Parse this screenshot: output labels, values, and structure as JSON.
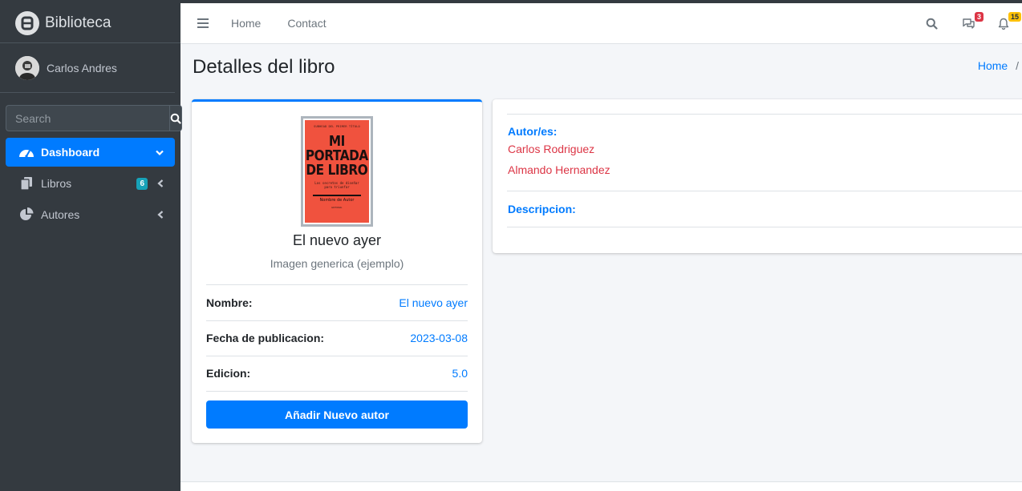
{
  "sidebar": {
    "brand": "Biblioteca",
    "user_name": "Carlos Andres",
    "search_placeholder": "Search",
    "items": [
      {
        "label": "Dashboard",
        "icon": "tachometer-icon"
      },
      {
        "label": "Libros",
        "icon": "copy-icon",
        "badge": "6"
      },
      {
        "label": "Autores",
        "icon": "pie-chart-icon"
      }
    ]
  },
  "navbar": {
    "links": [
      "Home",
      "Contact"
    ],
    "messages_badge": "3",
    "notifications_badge": "15"
  },
  "page": {
    "title": "Detalles del libro",
    "breadcrumb_home": "Home",
    "breadcrumb_sep": "/"
  },
  "book": {
    "cover": {
      "top_text": "SUBHEAD DEL PRIMER TÍTULO",
      "title_lines": [
        "MI",
        "PORTADA",
        "DE LIBRO"
      ],
      "subtitle_lines": [
        "Los secretos de diseñar",
        "para triunfar"
      ],
      "author": "Nombre de Autor",
      "bottom_text": "EDITORIAL"
    },
    "name": "El nuevo ayer",
    "image_caption": "Imagen generica (ejemplo)",
    "fields": [
      {
        "label": "Nombre:",
        "value": "El nuevo ayer"
      },
      {
        "label": "Fecha de publicacion:",
        "value": "2023-03-08"
      },
      {
        "label": "Edicion:",
        "value": "5.0"
      }
    ],
    "add_author_button": "Añadir Nuevo autor"
  },
  "details": {
    "authors_label": "Autor/es:",
    "authors": [
      "Carlos Rodriguez",
      "Almando Hernandez"
    ],
    "description_label": "Descripcion:"
  },
  "colors": {
    "primary": "#007bff",
    "danger": "#dc3545",
    "sidebar_bg": "#343a40",
    "cover_red": "#f0523e"
  }
}
